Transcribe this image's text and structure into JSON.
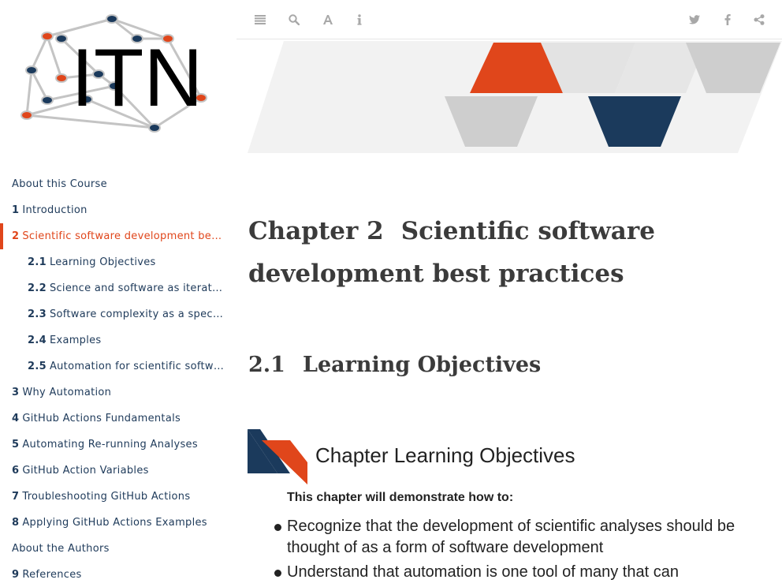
{
  "sidebar": {
    "logo_text": "ITN",
    "toc": [
      {
        "num": "",
        "label": "About this Course",
        "level": 1,
        "active": false
      },
      {
        "num": "1",
        "label": "Introduction",
        "level": 1,
        "active": false
      },
      {
        "num": "2",
        "label": "Scientific software development best …",
        "level": 1,
        "active": true
      },
      {
        "num": "2.1",
        "label": "Learning Objectives",
        "level": 2,
        "active": false
      },
      {
        "num": "2.2",
        "label": "Science and software as iterative …",
        "level": 2,
        "active": false
      },
      {
        "num": "2.3",
        "label": "Software complexity as a spectru…",
        "level": 2,
        "active": false
      },
      {
        "num": "2.4",
        "label": "Examples",
        "level": 2,
        "active": false
      },
      {
        "num": "2.5",
        "label": "Automation for scientific software",
        "level": 2,
        "active": false
      },
      {
        "num": "3",
        "label": "Why Automation",
        "level": 1,
        "active": false
      },
      {
        "num": "4",
        "label": "GitHub Actions Fundamentals",
        "level": 1,
        "active": false
      },
      {
        "num": "5",
        "label": "Automating Re-running Analyses",
        "level": 1,
        "active": false
      },
      {
        "num": "6",
        "label": "GitHub Action Variables",
        "level": 1,
        "active": false
      },
      {
        "num": "7",
        "label": "Troubleshooting GitHub Actions",
        "level": 1,
        "active": false
      },
      {
        "num": "8",
        "label": "Applying GitHub Actions Examples",
        "level": 1,
        "active": false
      },
      {
        "num": "",
        "label": "About the Authors",
        "level": 1,
        "active": false
      },
      {
        "num": "9",
        "label": "References",
        "level": 1,
        "active": false
      }
    ]
  },
  "toolbar": {
    "left_icons": [
      "menu-icon",
      "search-icon",
      "font-icon",
      "info-icon"
    ],
    "right_icons": [
      "twitter-icon",
      "facebook-icon",
      "share-icon"
    ]
  },
  "main": {
    "chapter": {
      "num": "Chapter 2",
      "title": "Scientific software development best practices"
    },
    "section": {
      "num": "2.1",
      "title": "Learning Objectives"
    },
    "objectives_box": {
      "heading": "Chapter Learning Objectives",
      "intro": "This chapter will demonstrate how to:",
      "items": [
        "Recognize that the development of scientific analyses should be thought of as a form of software development",
        "Understand that automation is one tool of many that can"
      ]
    }
  },
  "colors": {
    "accent": "#e0461b",
    "navy": "#1b3a5c",
    "toc_text": "#1e3a5a",
    "icon_gray": "#a8a8a8",
    "heading_text": "#3b3b3b"
  }
}
